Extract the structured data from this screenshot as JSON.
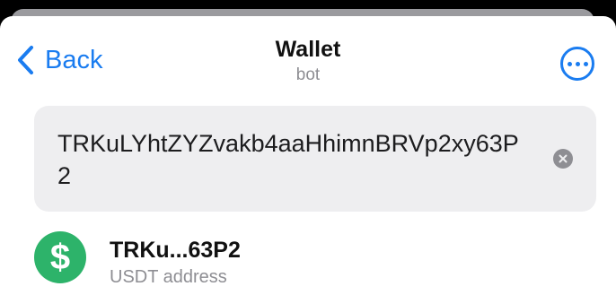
{
  "header": {
    "back_label": "Back",
    "title": "Wallet",
    "subtitle": "bot",
    "more_icon": "ellipsis-circle-icon",
    "accent": "#1a7cf0"
  },
  "search": {
    "value": "TRKuLYhtZYZvakb4aaHhimnBRVp2xy63P2",
    "clear_icon": "clear-x-icon"
  },
  "results": [
    {
      "title": "TRKu...63P2",
      "subtitle": "USDT address",
      "avatar_glyph": "$",
      "avatar_color": "#2db36a"
    }
  ]
}
